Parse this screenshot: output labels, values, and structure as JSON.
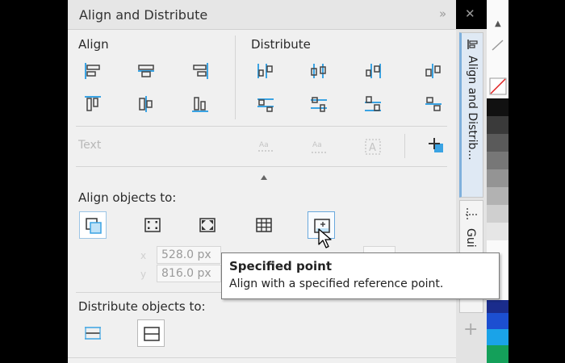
{
  "panel": {
    "title": "Align and Distribute",
    "expand_icon": "»",
    "close_icon": "✕"
  },
  "align": {
    "label": "Align"
  },
  "distribute": {
    "label": "Distribute"
  },
  "text_row": {
    "label": "Text",
    "icon_1": "Aa",
    "icon_2": "Aa",
    "icon_3": "A"
  },
  "align_to": {
    "label": "Align objects to:",
    "x_value": "528.0 px",
    "y_value": "816.0 px",
    "x_label": "x",
    "y_label": "y"
  },
  "tooltip": {
    "title": "Specified point",
    "description": "Align with a specified reference point."
  },
  "distribute_to": {
    "label": "Distribute objects to:"
  },
  "side_tabs": {
    "tab1": "Align and Distrib...",
    "tab2": "Gui"
  },
  "colors": {
    "accent": "#3aa3e3",
    "panel_bg": "#f0f0f0",
    "tooltip_border": "#7a7a7a"
  }
}
